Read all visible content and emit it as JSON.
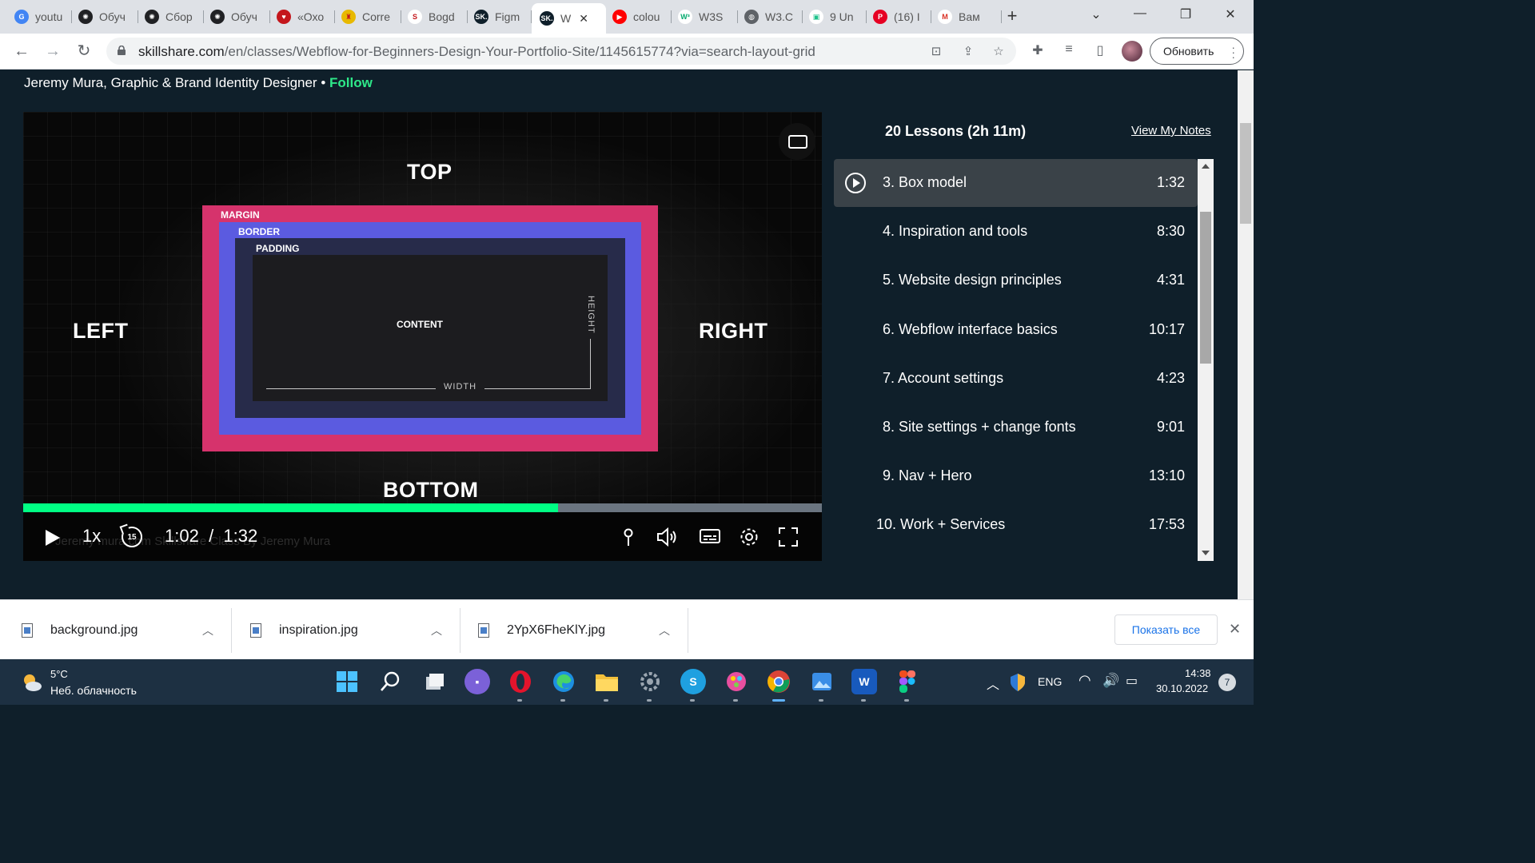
{
  "browser": {
    "tabs": [
      {
        "title": "youtu",
        "icon": "google-icon",
        "color": "#4285f4",
        "glyph": "G"
      },
      {
        "title": "Обуч",
        "icon": "openai-icon",
        "color": "#202124",
        "glyph": "✺"
      },
      {
        "title": "Сбор",
        "icon": "openai-icon",
        "color": "#202124",
        "glyph": "✺"
      },
      {
        "title": "Обуч",
        "icon": "openai-icon",
        "color": "#202124",
        "glyph": "✺"
      },
      {
        "title": "«Охо",
        "icon": "red-shape-icon",
        "color": "#c4161c",
        "glyph": "♥"
      },
      {
        "title": "Corre",
        "icon": "yellow-badge-icon",
        "color": "#e8b900",
        "glyph": "♜"
      },
      {
        "title": "Bogd",
        "icon": "s-logo-icon",
        "color": "#ffffff",
        "glyph": "S"
      },
      {
        "title": "Figm",
        "icon": "skillshare-icon",
        "color": "#0f1f2a",
        "glyph": "SK."
      },
      {
        "title": "W",
        "icon": "skillshare-icon",
        "color": "#0f1f2a",
        "glyph": "SK.",
        "active": true
      },
      {
        "title": "colou",
        "icon": "youtube-icon",
        "color": "#ff0000",
        "glyph": "▶"
      },
      {
        "title": "W3S",
        "icon": "w3schools-icon",
        "color": "#ffffff",
        "glyph": "W³"
      },
      {
        "title": "W3.C",
        "icon": "globe-icon",
        "color": "#5f6368",
        "glyph": "◍"
      },
      {
        "title": "9 Un",
        "icon": "green-square-icon",
        "color": "#ffffff",
        "glyph": "▣"
      },
      {
        "title": "(16) I",
        "icon": "pinterest-icon",
        "color": "#e60023",
        "glyph": "P"
      },
      {
        "title": "Вам",
        "icon": "gmail-icon",
        "color": "#ffffff",
        "glyph": "M"
      }
    ],
    "url_host": "skillshare.com",
    "url_path": "/en/classes/Webflow-for-Beginners-Design-Your-Portfolio-Site/1145615774?via=search-layout-grid",
    "update_label": "Обновить"
  },
  "page": {
    "instructor_text": "Jeremy Mura, Graphic & Brand Identity Designer • ",
    "follow_label": "Follow"
  },
  "video": {
    "labels": {
      "top": "TOP",
      "bottom": "BOTTOM",
      "left": "LEFT",
      "right": "RIGHT",
      "margin": "MARGIN",
      "border": "BORDER",
      "padding": "PADDING",
      "content": "CONTENT",
      "width": "WIDTH",
      "height": "HEIGHT"
    },
    "colors": {
      "margin": "#d6336c",
      "border": "#5b5be0",
      "padding": "#272b4a",
      "progress": "#00ff84"
    },
    "progress_fraction": 0.67,
    "speed": "1x",
    "rewind_seconds": "15",
    "current_time": "1:02",
    "time_separator": "/",
    "total_time": "1:32",
    "watermark": "Jeremy mura.com        Skillshare Class By Jeremy Mura"
  },
  "lessons": {
    "header": "20 Lessons (2h 11m)",
    "notes_label": "View My Notes",
    "items": [
      {
        "title": "3. Box model",
        "duration": "1:32",
        "active": true
      },
      {
        "title": "4. Inspiration and tools",
        "duration": "8:30"
      },
      {
        "title": "5. Website design principles",
        "duration": "4:31"
      },
      {
        "title": "6. Webflow interface basics",
        "duration": "10:17"
      },
      {
        "title": "7. Account settings",
        "duration": "4:23"
      },
      {
        "title": "8. Site settings + change fonts",
        "duration": "9:01"
      },
      {
        "title": "9. Nav + Hero",
        "duration": "13:10"
      },
      {
        "title": "10. Work + Services",
        "duration": "17:53"
      }
    ]
  },
  "downloads": {
    "items": [
      "background.jpg",
      "inspiration.jpg",
      "2YpX6FheKlY.jpg"
    ],
    "show_all": "Показать все"
  },
  "taskbar": {
    "temp": "5°C",
    "weather": "Неб. облачность",
    "lang": "ENG",
    "time": "14:38",
    "date": "30.10.2022",
    "notifications": "7"
  }
}
